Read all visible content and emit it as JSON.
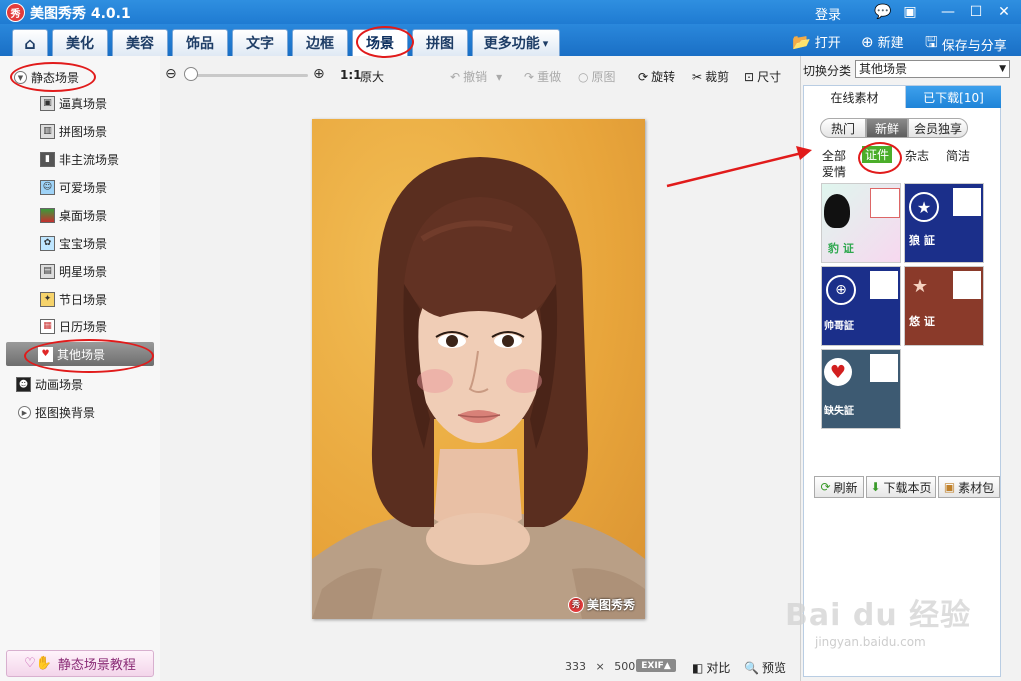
{
  "window": {
    "logo_char": "秀",
    "title": "美图秀秀 4.0.1",
    "login": "登录",
    "controls": {
      "feedback": "💬",
      "restore": "▣",
      "minimize": "—",
      "maximize": "☐",
      "close": "✕"
    }
  },
  "menu": {
    "home_icon": "⌂",
    "tabs": [
      "美化",
      "美容",
      "饰品",
      "文字",
      "边框",
      "场景",
      "拼图",
      "更多功能"
    ],
    "more_arrow": "▾",
    "open": "打开",
    "new": "新建",
    "save_share": "保存与分享"
  },
  "left": {
    "static_scenes": "静态场景",
    "items": [
      "逼真场景",
      "拼图场景",
      "非主流场景",
      "可爱场景",
      "桌面场景",
      "宝宝场景",
      "明星场景",
      "节日场景",
      "日历场景",
      "其他场景"
    ],
    "animated": "动画场景",
    "cutout": "抠图换背景",
    "tutorial": "静态场景教程"
  },
  "toolbar": {
    "ratio": "1:1",
    "original_size": "原大",
    "undo": "撤销",
    "redo": "重做",
    "original": "原图",
    "rotate": "旋转",
    "crop": "裁剪",
    "resize": "尺寸"
  },
  "canvas": {
    "watermark_logo": "秀",
    "watermark": "美图秀秀"
  },
  "status": {
    "width": "333",
    "times": "×",
    "height": "500",
    "exif": "EXIF▲",
    "compare": "对比",
    "preview": "预览"
  },
  "right": {
    "switch_category": "切换分类",
    "category": "其他场景",
    "tab_online": "在线素材",
    "tab_downloaded": "已下载[10]",
    "segments": [
      "热门",
      "新鲜",
      "会员独享"
    ],
    "filters": [
      "全部",
      "证件",
      "杂志",
      "简洁",
      "爱情"
    ],
    "thumbs": [
      {
        "caption": "豹 证"
      },
      {
        "caption": "狼 証"
      },
      {
        "caption": "帅哥証"
      },
      {
        "caption": "悠 证"
      },
      {
        "caption": "缺失証"
      }
    ],
    "refresh": "刷新",
    "download_page": "下载本页",
    "material_pack": "素材包"
  },
  "site": {
    "brand": "Bai du 经验",
    "url": "jingyan.baidu.com"
  }
}
